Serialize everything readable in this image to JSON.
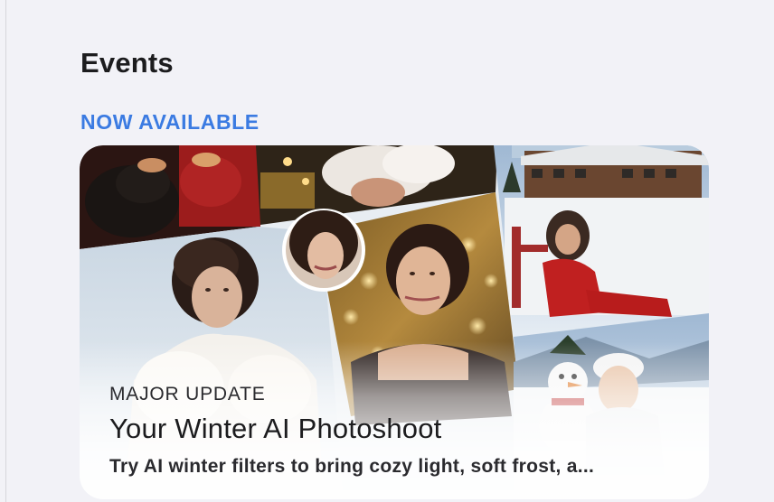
{
  "events": {
    "section_title": "Events",
    "eyebrow": "NOW AVAILABLE",
    "card": {
      "kicker": "MAJOR UPDATE",
      "title": "Your Winter AI Photoshoot",
      "subtitle": "Try AI winter filters to bring cozy light, soft frost, a..."
    }
  },
  "colors": {
    "accent": "#3b7be2",
    "background": "#f2f2f7",
    "text": "#1c1c1e"
  }
}
